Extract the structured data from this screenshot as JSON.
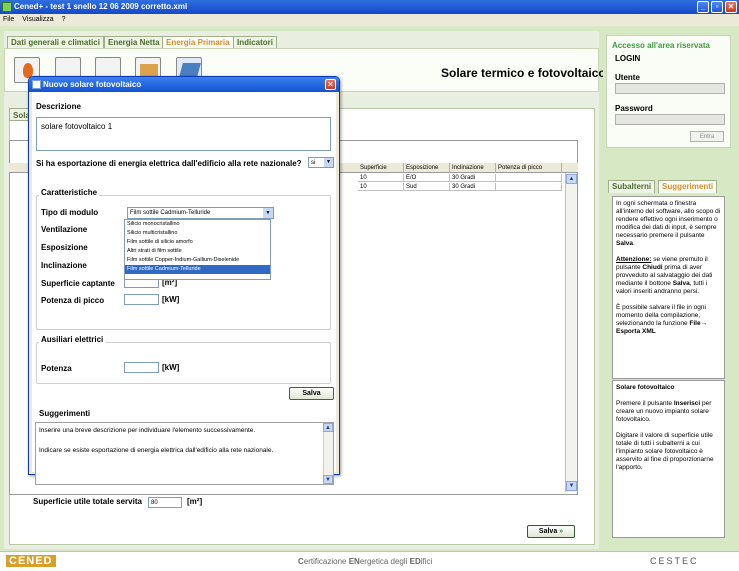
{
  "window": {
    "title": "Cened+ - test 1 snello 12 06 2009 corretto.xml"
  },
  "menu": [
    "File",
    "Visualizza",
    "?"
  ],
  "tabs": [
    "Dati generali e climatici",
    "Energia Netta",
    "Energia Primaria",
    "Indicatori"
  ],
  "section_title": "Solare termico e fotovoltaico",
  "subtab": "Sola",
  "grid": {
    "headers": [
      "Superficie",
      "Esposizione",
      "Inclinazione",
      "Potenza di picco"
    ],
    "rows": [
      [
        "10",
        "E/O",
        "30 Gradi",
        ""
      ],
      [
        "10",
        "Sud",
        "30 Gradi",
        ""
      ]
    ]
  },
  "surface": {
    "label": "Superficie utile totale servita",
    "value": "80",
    "unit": "[m²]"
  },
  "main_save": "Salva",
  "login": {
    "header": "Accesso all'area riservata",
    "login_label": "LOGIN",
    "user_label": "Utente",
    "pass_label": "Password",
    "enter": "Entra"
  },
  "right_tabs": [
    "Subalterni",
    "Suggerimenti"
  ],
  "help1": {
    "p1": "In ogni schermata o finestra all'interno del software, allo scopo di rendere effettivo ogni inserimento o modifica dei dati di input, è sempre necessario premere il pulsante",
    "p1b": "Salva",
    "p2a": "Attenzione:",
    "p2": " se viene premuto il pulsante ",
    "p2b": "Chiudi",
    "p2c": " prima di aver provveduto al salvataggio dei dati mediante il bottone ",
    "p2d": "Salva",
    "p2e": ", tutti i valori inseriti andranno persi.",
    "p3": "È possibile salvare il file in ogni momento della compilazione, selezionando la funzione ",
    "p3b": "File→ Esporta XML"
  },
  "help2": {
    "title": "Solare fotovoltaico",
    "p1a": "Premere il pulsante ",
    "p1b": "Inserisci",
    "p1c": " per creare un nuovo impianto solare fotovoltaico.",
    "p2": "Digitare il valore di superficie utile totale di tutti i subalterni a cui l'impianto solare fotovoltaico è asservito al fine di proporzionarne l'apporto."
  },
  "footer": {
    "logo": "CENED",
    "text_a": "C",
    "text_b": "ertificazione ",
    "text_c": "EN",
    "text_d": "ergetica degli ",
    "text_e": "ED",
    "text_f": "ifici",
    "brand": "CESTEC"
  },
  "dialog": {
    "title": "Nuovo solare fotovoltaico",
    "desc_label": "Descrizione",
    "desc_value": "solare fotovoltaico 1",
    "export_q": "Si ha esportazione di energia elettrica dall'edificio alla rete nazionale?",
    "export_val": "si",
    "char_group": "Caratteristiche",
    "tipo_label": "Tipo di modulo",
    "tipo_value": "Film sottile Cadmium-Telluride",
    "options": [
      "Silicio monocristallino",
      "Silicio multicristallino",
      "Film sottile di silicio amorfo",
      "Altri strati di film sottile",
      "Film sottile Copper-Indium-Gallium-Diselenide",
      "Film sottile Cadmium-Telluride"
    ],
    "vent_label": "Ventilazione",
    "esp_label": "Esposizione",
    "incl_label": "Inclinazione",
    "sup_label": "Superficie captante",
    "sup_unit": "[m²]",
    "pot_label": "Potenza di picco",
    "pot_unit": "[kW]",
    "aux_group": "Ausiliari elettrici",
    "pow_label": "Potenza",
    "pow_unit": "[kW]",
    "save": "Salva",
    "sugg_label": "Suggerimenti",
    "sugg1": "Inserire una breve descrizione per individuare l'elemento successivamente.",
    "sugg2": "Indicare se esiste esportazione di energia elettrica dall'edificio alla rete nazionale."
  }
}
